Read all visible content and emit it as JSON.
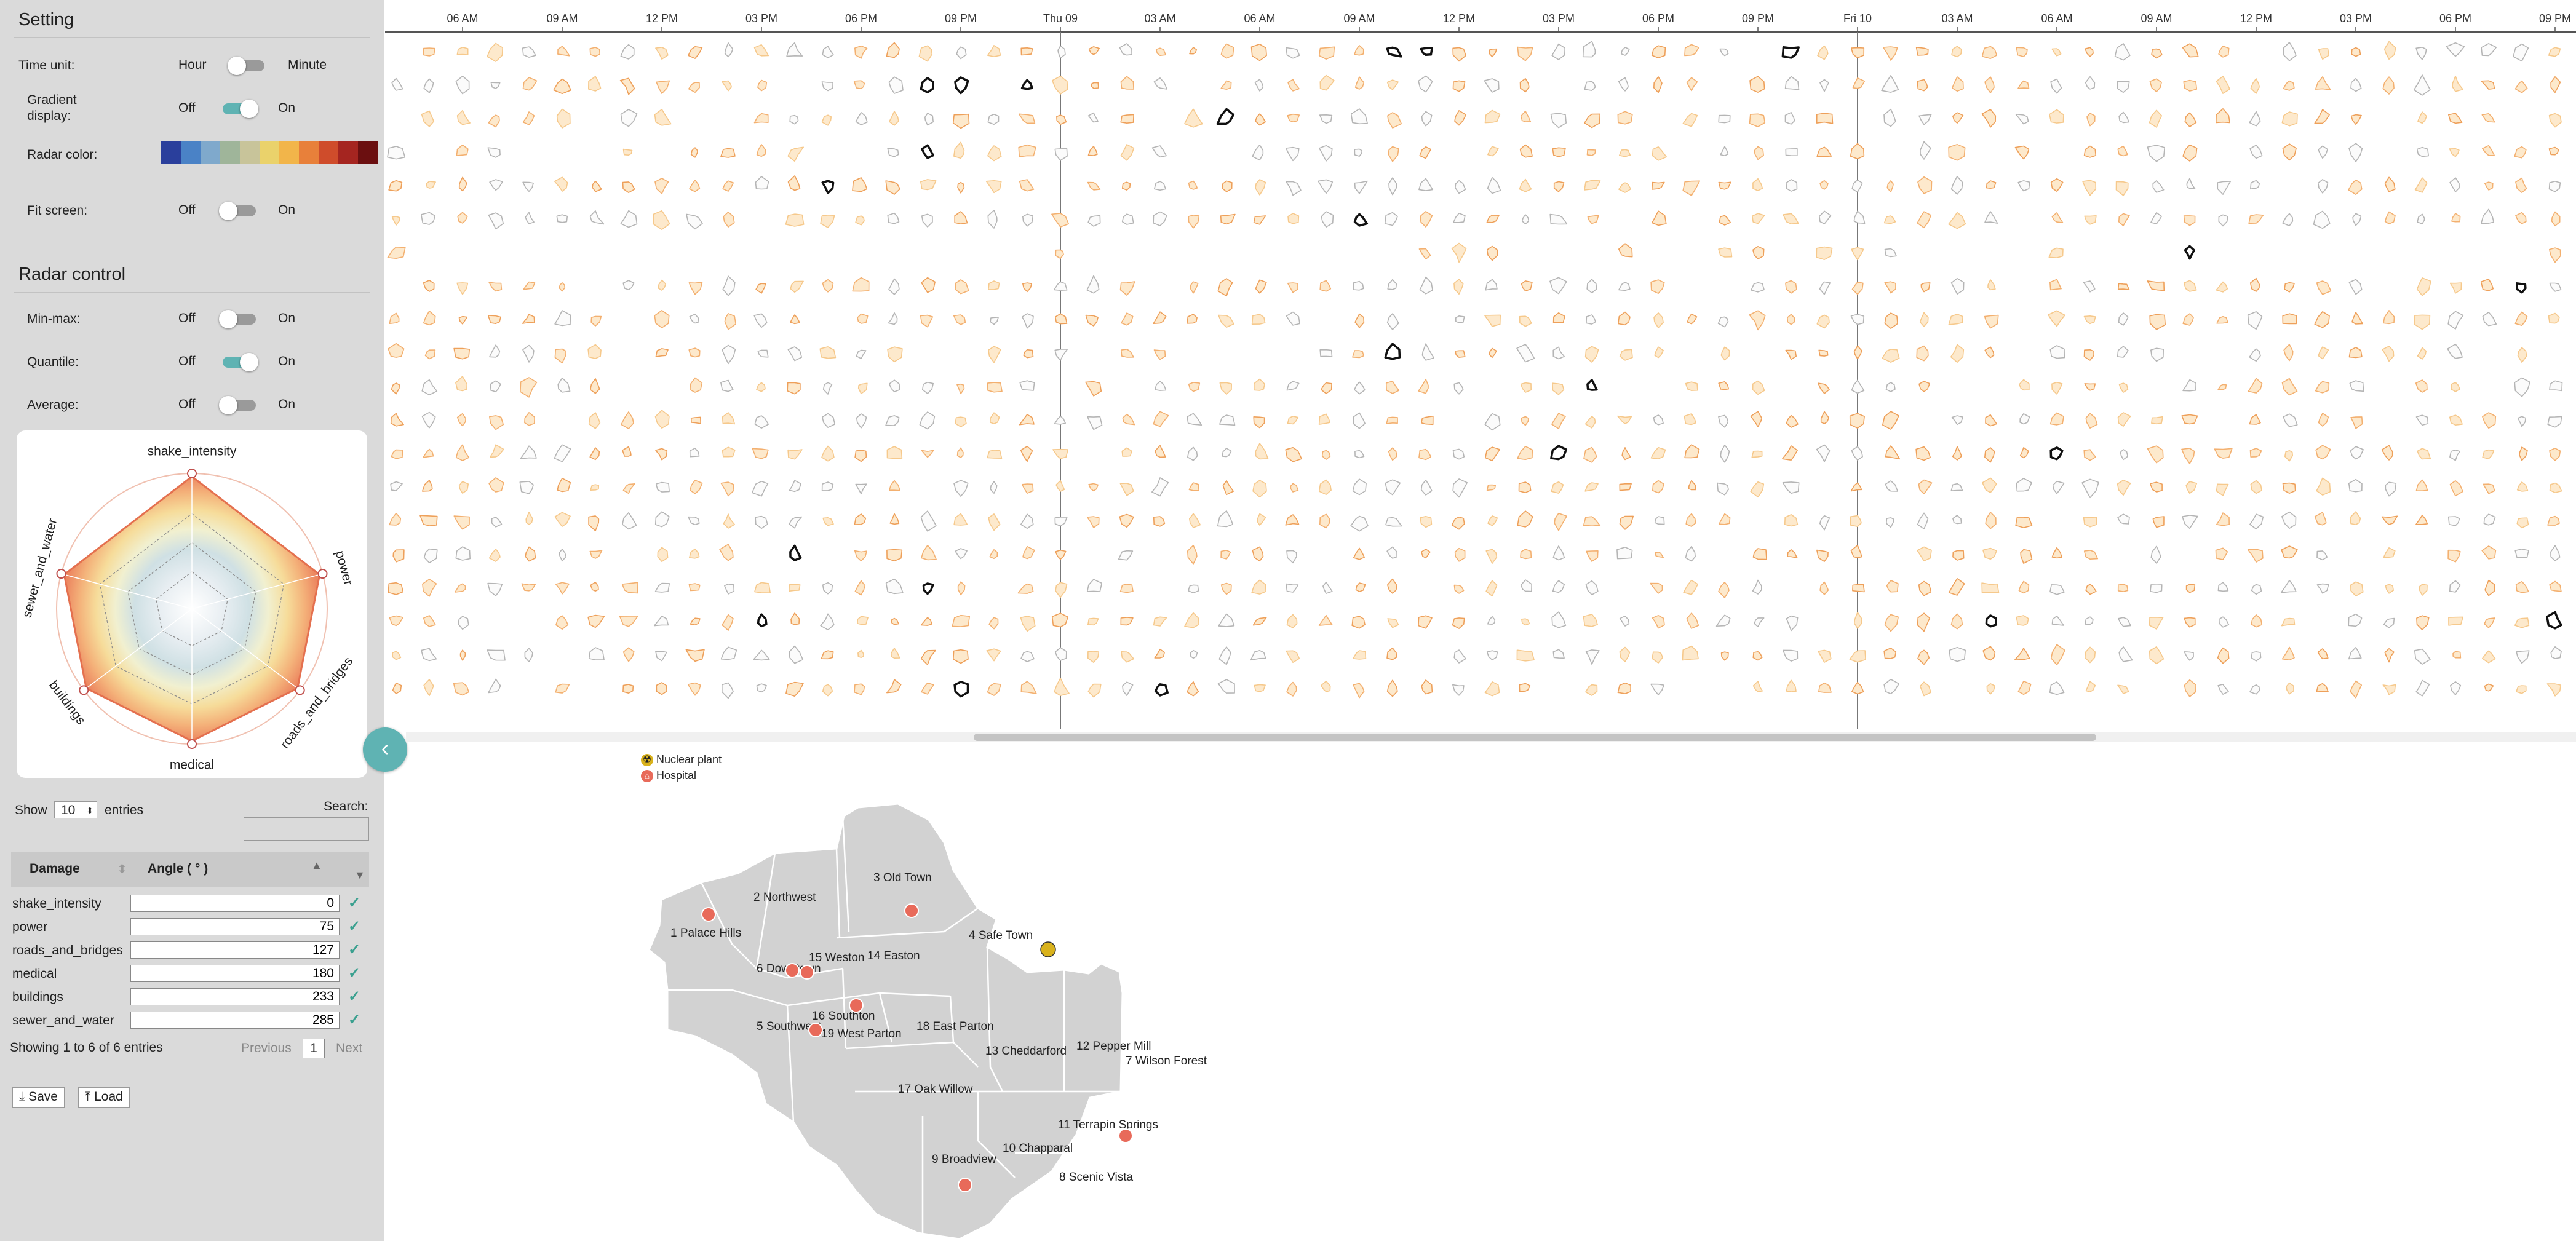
{
  "setting": {
    "title": "Setting",
    "time_unit": {
      "label": "Time unit:",
      "left": "Hour",
      "right": "Minute",
      "on": false
    },
    "gradient": {
      "label": "Gradient display:",
      "off": "Off",
      "on_label": "On",
      "on": true
    },
    "radar_color": {
      "label": "Radar color:",
      "colors": [
        "#2a3f9c",
        "#4a82c6",
        "#7fa9cc",
        "#9fb59a",
        "#c8c49a",
        "#ead26b",
        "#f2b54a",
        "#e8803a",
        "#cf4c2b",
        "#a52520",
        "#6b0f10"
      ]
    },
    "fit_screen": {
      "label": "Fit screen:",
      "off": "Off",
      "on_label": "On",
      "on": false
    }
  },
  "radar_control": {
    "title": "Radar control",
    "minmax": {
      "label": "Min-max:",
      "off": "Off",
      "on_label": "On",
      "on": false
    },
    "quantile": {
      "label": "Quantile:",
      "off": "Off",
      "on_label": "On",
      "on": true
    },
    "average": {
      "label": "Average:",
      "off": "Off",
      "on_label": "On",
      "on": false
    }
  },
  "radar_axes": [
    "shake_intensity",
    "power",
    "roads_and_bridges",
    "medical",
    "buildings",
    "sewer_and_water"
  ],
  "table": {
    "show": "Show",
    "entries_value": "10",
    "entries": "entries",
    "search_label": "Search:",
    "columns": [
      "Damage",
      "Angle ( ° )"
    ],
    "rows": [
      {
        "name": "shake_intensity",
        "angle": "0"
      },
      {
        "name": "power",
        "angle": "75"
      },
      {
        "name": "roads_and_bridges",
        "angle": "127"
      },
      {
        "name": "medical",
        "angle": "180"
      },
      {
        "name": "buildings",
        "angle": "233"
      },
      {
        "name": "sewer_and_water",
        "angle": "285"
      }
    ],
    "info": "Showing 1 to 6 of 6 entries",
    "previous": "Previous",
    "page": "1",
    "next": "Next"
  },
  "buttons": {
    "save": "Save",
    "load": "Load"
  },
  "timeline": {
    "ticks": [
      "06 AM",
      "09 AM",
      "12 PM",
      "03 PM",
      "06 PM",
      "09 PM",
      "Thu 09",
      "03 AM",
      "06 AM",
      "09 AM",
      "12 PM",
      "03 PM",
      "06 PM",
      "09 PM",
      "Fri 10",
      "03 AM",
      "06 AM",
      "09 AM",
      "12 PM",
      "03 PM",
      "06 PM",
      "09 PM"
    ],
    "day_markers": [
      "Thu 09",
      "Fri 10"
    ]
  },
  "legend": {
    "nuclear": "Nuclear plant",
    "hospital": "Hospital"
  },
  "map": {
    "regions": [
      "1 Palace Hills",
      "2 Northwest",
      "3 Old Town",
      "4 Safe Town",
      "5 Southwest",
      "6 Downtown",
      "7 Wilson Forest",
      "8 Scenic Vista",
      "9 Broadview",
      "10 Chapparal",
      "11 Terrapin Springs",
      "12 Pepper Mill",
      "13 Cheddarford",
      "14 Easton",
      "15 Weston",
      "16 Southton",
      "17 Oak Willow",
      "18 East Parton",
      "19 West Parton"
    ]
  }
}
